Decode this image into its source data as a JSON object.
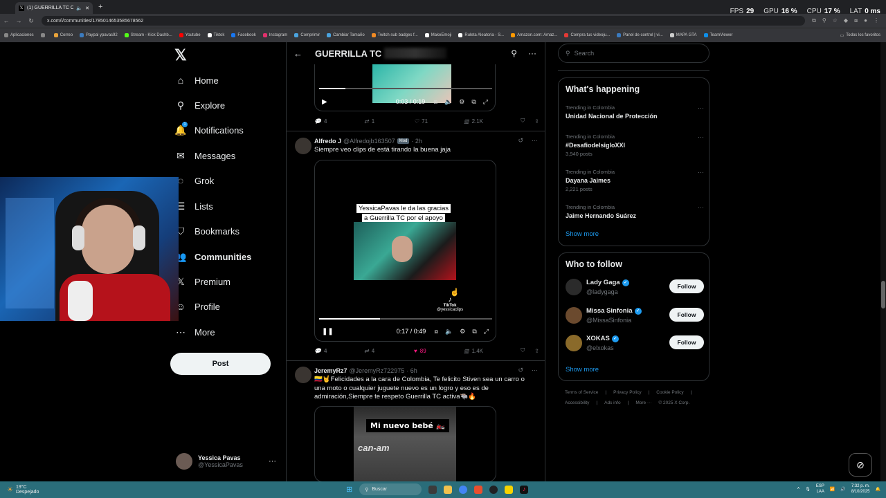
{
  "browser": {
    "tab_title": "(1) GUERRILLA TC Commu...",
    "url": "x.com/i/communities/1785014653585678562",
    "overlay": [
      {
        "label": "FPS",
        "value": "29"
      },
      {
        "label": "GPU",
        "value": "16 %"
      },
      {
        "label": "CPU",
        "value": "17 %"
      },
      {
        "label": "LAT",
        "value": "0 ms"
      }
    ],
    "bookmarks": [
      {
        "label": "Aplicaciones",
        "color": "#888888"
      },
      {
        "label": "",
        "color": "#888888"
      },
      {
        "label": "Correo",
        "color": "#e8a33a"
      },
      {
        "label": "Paypal ypavas92",
        "color": "#3b7bbf"
      },
      {
        "label": "Stream - Kick Dashb...",
        "color": "#53fc18"
      },
      {
        "label": "Youtube",
        "color": "#ff0000"
      },
      {
        "label": "Tiktok",
        "color": "#ffffff"
      },
      {
        "label": "Facebook",
        "color": "#1877f2"
      },
      {
        "label": "Instagram",
        "color": "#e1306c"
      },
      {
        "label": "Comprimir",
        "color": "#4aa3df"
      },
      {
        "label": "Cambiar Tamaño",
        "color": "#4aa3df"
      },
      {
        "label": "Twitch sub badges f...",
        "color": "#f08a24"
      },
      {
        "label": "MakeEmoji",
        "color": "#ffffff"
      },
      {
        "label": "Ruleta Aleatoria - S...",
        "color": "#ffffff"
      },
      {
        "label": "Amazon.com: Amaz...",
        "color": "#ff9900"
      },
      {
        "label": "Compra tus videoju...",
        "color": "#e53935"
      },
      {
        "label": "Panel de control | vi...",
        "color": "#3b7bbf"
      },
      {
        "label": "MAPA GTA",
        "color": "#cccccc"
      },
      {
        "label": "TeamViewer",
        "color": "#0e8ee9"
      }
    ],
    "bookmarks_right": "Todos los favoritos"
  },
  "nav": {
    "items": [
      {
        "label": "Home",
        "icon": "⌂",
        "bold": false
      },
      {
        "label": "Explore",
        "icon": "⚲",
        "bold": false
      },
      {
        "label": "Notifications",
        "icon": "🔔",
        "bold": false
      },
      {
        "label": "Messages",
        "icon": "✉",
        "bold": false
      },
      {
        "label": "Grok",
        "icon": "◌",
        "bold": false
      },
      {
        "label": "Lists",
        "icon": "☰",
        "bold": false
      },
      {
        "label": "Bookmarks",
        "icon": "⛉",
        "bold": false
      },
      {
        "label": "Communities",
        "icon": "👥",
        "bold": true
      },
      {
        "label": "Premium",
        "icon": "𝕏",
        "bold": false
      },
      {
        "label": "Profile",
        "icon": "☺",
        "bold": false
      },
      {
        "label": "More",
        "icon": "⋯",
        "bold": false
      }
    ],
    "notif_badge": "1",
    "post_label": "Post",
    "account": {
      "name": "Yessica Pavas",
      "handle": "@YessicaPavas"
    }
  },
  "feed": {
    "title": "GUERRILLA TC",
    "video1": {
      "time": "0:03 / 0:19",
      "progress": 0.15
    },
    "post1_actions": {
      "replies": "4",
      "reposts": "1",
      "likes": "71",
      "views": "2.1K"
    },
    "post2": {
      "name": "Alfredo J",
      "handle": "@Alfredojb163507",
      "badge": "Mod",
      "time": "· 2h",
      "text": "Siempre veo clips de está tirando la buena jaja",
      "caption": "YessicaPavas le da las gracias a Guerrilla TC por el apoyo",
      "tiktok": "TikTok",
      "tiktok_handle": "@yessicaclips",
      "video_time": "0:17 / 0:49",
      "progress": 0.35,
      "actions": {
        "replies": "4",
        "reposts": "4",
        "likes": "89",
        "views": "1.4K"
      }
    },
    "post3": {
      "name": "JeremyRz7",
      "handle": "@JeremyRz722975",
      "time": "· 6h",
      "text": "🇨🇴🤘Felicidades a la cara de Colombia, Te felicito Stiven sea un carro o una moto o cualquier juguete nuevo es un logro y eso es de admiración,Siempre te respeto Guerrilla TC activa🐃🔥",
      "media_label": "Mi nuevo bebé 🏍️",
      "media_brand": "can-am"
    }
  },
  "sidebar": {
    "search_placeholder": "Search",
    "happening_title": "What's happening",
    "trends": [
      {
        "context": "Trending in Colombia",
        "name": "Unidad Nacional de Protección",
        "posts": ""
      },
      {
        "context": "Trending in Colombia",
        "name": "#DesafiodelsigloXXI",
        "posts": "3,940 posts"
      },
      {
        "context": "Trending in Colombia",
        "name": "Dayana Jaimes",
        "posts": "2,221 posts"
      },
      {
        "context": "Trending in Colombia",
        "name": "Jaime Hernando Suárez",
        "posts": ""
      }
    ],
    "show_more": "Show more",
    "follow_title": "Who to follow",
    "follows": [
      {
        "name": "Lady Gaga",
        "handle": "@ladygaga",
        "color": "#2b2b2b"
      },
      {
        "name": "Missa Sinfonia",
        "handle": "@MissaSinfonia",
        "color": "#6b4a2e"
      },
      {
        "name": "XOKAS",
        "handle": "@elxokas",
        "color": "#8a6a2a"
      }
    ],
    "follow_label": "Follow",
    "footer1": [
      "Terms of Service",
      "|",
      "Privacy Policy",
      "|",
      "Cookie Policy",
      "|"
    ],
    "footer2": [
      "Accessibility",
      "|",
      "Ads info",
      "|",
      "More ···",
      "© 2025 X Corp."
    ]
  },
  "taskbar": {
    "temp": "19°C",
    "weather": "Despejado",
    "search": "Buscar",
    "lang": "ESP",
    "lang2": "LAA",
    "time": "7:32 p. m.",
    "date": "8/10/2025"
  }
}
